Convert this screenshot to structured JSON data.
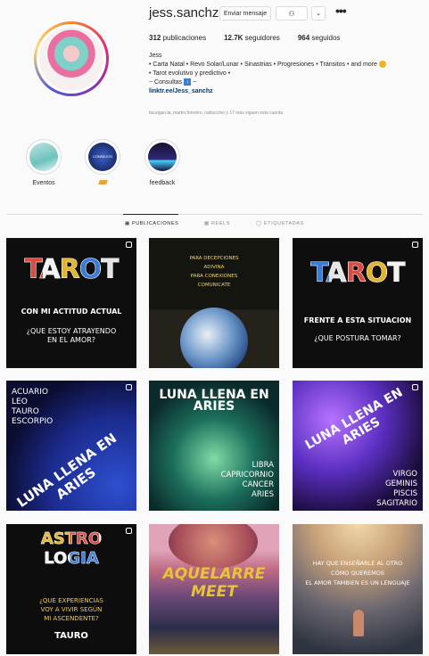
{
  "profile": {
    "username": "jess.sanchz",
    "message_button": "Enviar mensaje",
    "more_label": "•••",
    "stats": {
      "posts": "312",
      "posts_label": "publicaciones",
      "followers": "12.7K",
      "followers_label": "seguidores",
      "following": "964",
      "following_label": "seguidos"
    },
    "bio": {
      "name": "Jess",
      "line1": "• Carta Natal • Revo Solar/Lunar • Sinastrias • Progresiones • Tránsitos • and more",
      "line2": "• Tarot evolutivo y predictivo •",
      "line3": "~ Consultas",
      "line3_end": "~",
      "link": "linktr.ee/Jess_sanchz"
    },
    "followed_by": "facutgarcia, martin.forneiro, nattuccino y 17 más siguen esta cuenta"
  },
  "highlights": [
    {
      "label": "Eventos"
    },
    {
      "label": ""
    },
    {
      "label": "feedback"
    }
  ],
  "highlight_inner_text": "CONSEJOS",
  "tabs": [
    {
      "label": "PUBLICACIONES"
    },
    {
      "label": "REELS"
    },
    {
      "label": "ETIQUETADAS"
    }
  ],
  "posts": [
    {
      "title": "TAROT",
      "line1": "CON MI ACTITUD ACTUAL",
      "line2": "¿QUE ESTOY ATRAYENDO",
      "line3": "EN EL AMOR?"
    },
    {
      "title": "",
      "line1": "PARA DECEPCIONES",
      "line2": "ADIVINA",
      "line3": "PARA CONEXIONES",
      "line4": "COMUNICATE"
    },
    {
      "title": "TAROT",
      "line1": "FRENTE A ESTA SITUACION",
      "line2": "¿QUE POSTURA TOMAR?"
    },
    {
      "title": "LUNA LLENA EN ARIES",
      "signs": [
        "ACUARIO",
        "LEO",
        "TAURO",
        "ESCORPIO"
      ]
    },
    {
      "title": "LUNA LLENA EN ARIES",
      "signs": [
        "LIBRA",
        "CAPRICORNIO",
        "CANCER",
        "ARIES"
      ]
    },
    {
      "title": "LUNA LLENA EN ARIES",
      "signs": [
        "VIRGO",
        "GEMINIS",
        "PISCIS",
        "SAGITARIO"
      ]
    },
    {
      "title": "ASTRO LOGIA",
      "line1": "¿QUE EXPERIENCIAS",
      "line2": "VOY A VIVIR SEGÚN",
      "line3": "MI ASCENDENTE?",
      "line4": "TAURO"
    },
    {
      "title": "AQUELARRE MEET"
    },
    {
      "line1": "HAY QUE ENSEÑARLE AL OTRO",
      "line2": "CÓMO QUEREMOS",
      "line3": "EL AMOR TAMBIEN ES UN LENGUAJE"
    }
  ],
  "colors": {
    "accent_link": "#00376b",
    "border": "#dbdbdb",
    "muted": "#8e8e8e"
  }
}
